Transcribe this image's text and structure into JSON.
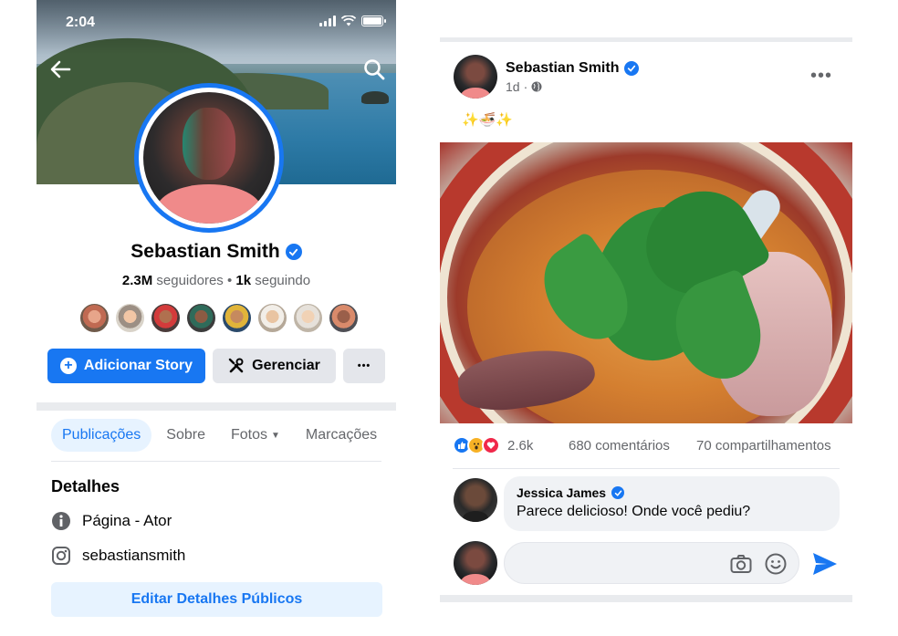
{
  "status_bar": {
    "time": "2:04"
  },
  "profile": {
    "name": "Sebastian Smith",
    "followers_count": "2.3M",
    "followers_label": " seguidores • ",
    "following_count": "1k",
    "following_label": " seguindo"
  },
  "actions": {
    "add_story": "Adicionar Story",
    "manage": "Gerenciar",
    "more": "•••"
  },
  "tabs": [
    {
      "label": "Publicações",
      "active": true
    },
    {
      "label": "Sobre"
    },
    {
      "label": "Fotos"
    },
    {
      "label": "Marcações"
    }
  ],
  "details": {
    "title": "Detalhes",
    "page_type": "Página - Ator",
    "instagram": "sebastiansmith",
    "edit_button": "Editar Detalhes Públicos"
  },
  "post": {
    "author": "Sebastian Smith",
    "time": "1d",
    "meta_sep": "·",
    "text": "✨🍜✨",
    "more": "•••",
    "reactions_count": "2.6k",
    "comments": "680 comentários",
    "shares": "70 compartilhamentos"
  },
  "comment": {
    "author": "Jessica James",
    "text": "Parece delicioso! Onde você pediu?"
  },
  "composer": {
    "placeholder": ""
  },
  "colors": {
    "brand": "#1877f2",
    "like": "#1877f2",
    "love": "#f0284a",
    "wow": "#f7b125"
  }
}
